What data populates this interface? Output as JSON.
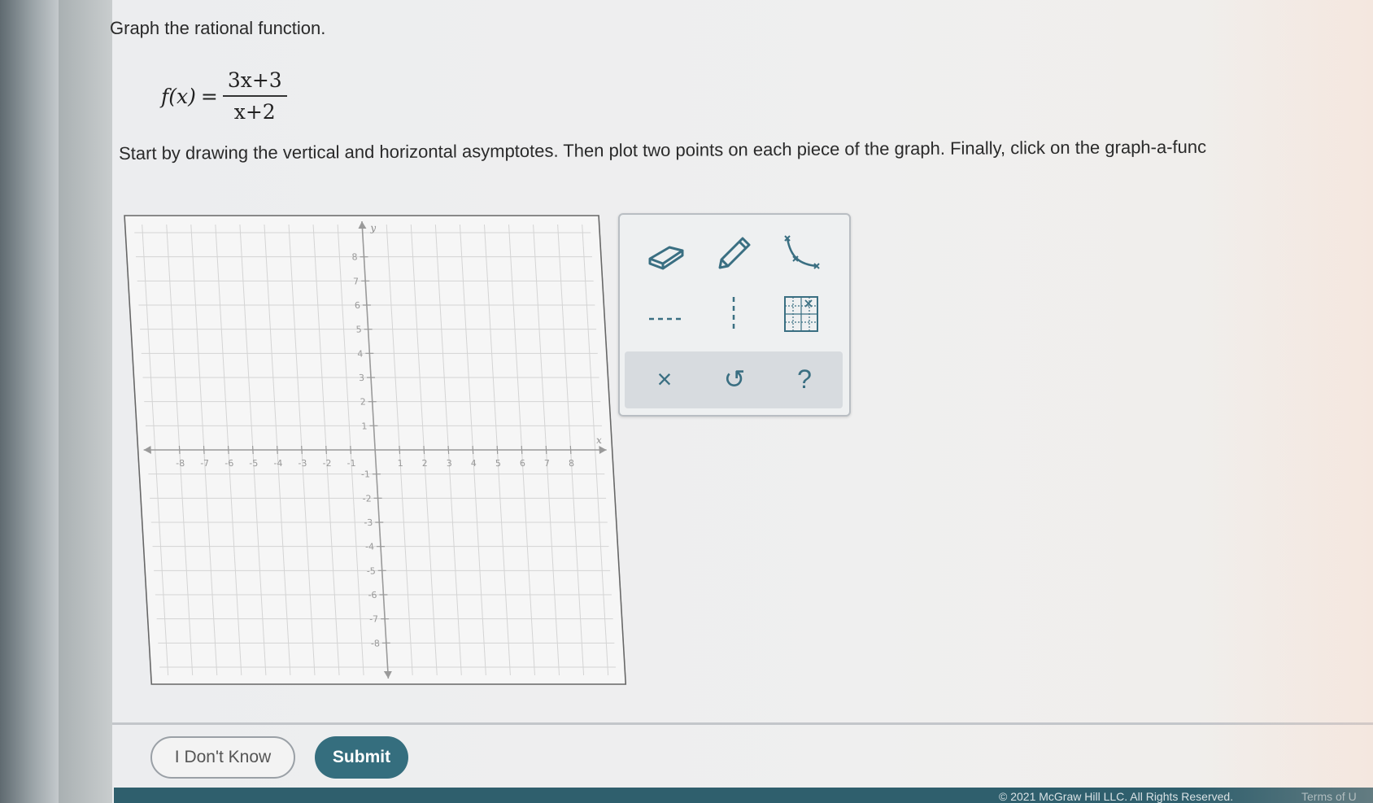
{
  "question": {
    "title": "Graph the rational function.",
    "function_lhs": "f(x)",
    "equals": "=",
    "numerator": "3x+3",
    "denominator": "x+2",
    "instructions": "Start by drawing the vertical and horizontal asymptotes. Then plot two points on each piece of the graph. Finally, click on the graph-a-func"
  },
  "graph": {
    "x_axis_label": "x",
    "y_axis_label": "y",
    "x_range": [
      -8,
      8
    ],
    "y_range": [
      -8,
      8
    ],
    "x_tick_labels": [
      "-8",
      "-7",
      "-6",
      "-5",
      "-4",
      "-3",
      "-2",
      "-1",
      "1",
      "2",
      "3",
      "4",
      "5",
      "6",
      "7",
      "8"
    ],
    "y_tick_labels": [
      "8",
      "7",
      "6",
      "5",
      "4",
      "3",
      "2",
      "1",
      "-1",
      "-2",
      "-3",
      "-4",
      "-5",
      "-6",
      "-7",
      "-8"
    ],
    "grid": true
  },
  "tools": {
    "row1": [
      {
        "name": "eraser-tool",
        "icon": "eraser-icon"
      },
      {
        "name": "pencil-tool",
        "icon": "pencil-icon"
      },
      {
        "name": "graph-a-function-tool",
        "icon": "curve-icon"
      }
    ],
    "row2": [
      {
        "name": "horizontal-asymptote-tool",
        "icon": "dashed-horizontal-line-icon"
      },
      {
        "name": "vertical-asymptote-tool",
        "icon": "dashed-vertical-line-icon"
      },
      {
        "name": "grid-toggle-tool",
        "icon": "grid-icon"
      }
    ],
    "actions": {
      "clear": "×",
      "undo": "↺",
      "help": "?"
    }
  },
  "buttons": {
    "dont_know": "I Don't Know",
    "submit": "Submit"
  },
  "footer": {
    "copyright": "© 2021 McGraw Hill LLC. All Rights Reserved.",
    "terms": "Terms of U"
  },
  "colors": {
    "accent": "#356e7e",
    "tool_icon": "#3a6f82",
    "footer_bar": "#2f5f6d"
  }
}
